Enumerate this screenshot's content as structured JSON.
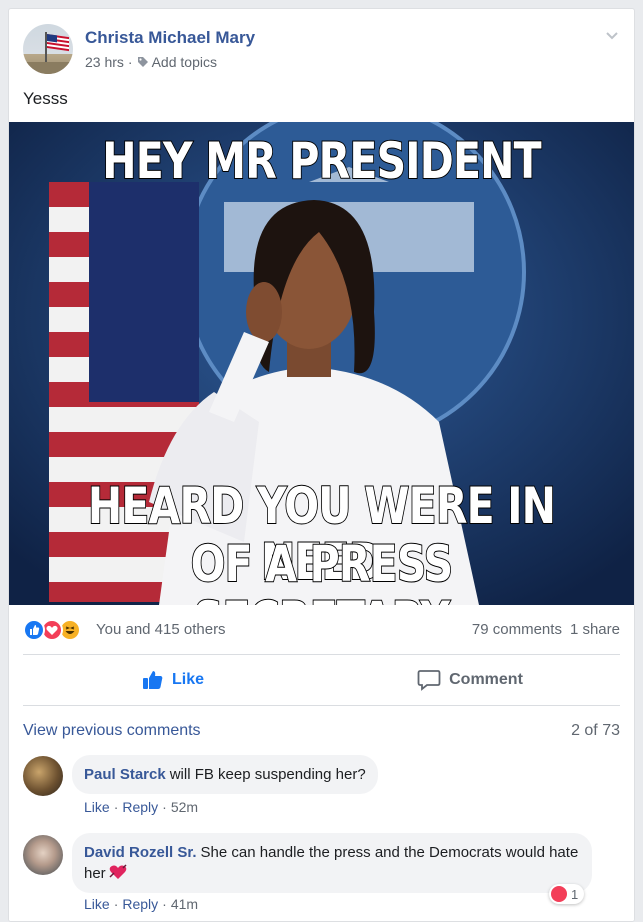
{
  "post": {
    "author": "Christa Michael Mary",
    "time": "23 hrs",
    "add_topics": "Add topics",
    "text": "Yesss",
    "meme_top": "HEY MR PRESIDENT",
    "meme_bottom_1": "HEARD YOU WERE IN NEED",
    "meme_bottom_2": "OF A PRESS SECRETARY",
    "reactors": "You and 415 others",
    "comments_count": "79 comments",
    "shares": "1 share",
    "reaction_icons": [
      "like-icon",
      "love-icon",
      "haha-icon"
    ]
  },
  "actions": {
    "like_label": "Like",
    "comment_label": "Comment"
  },
  "comments": {
    "view_previous": "View previous comments",
    "count": "2 of 73",
    "items": [
      {
        "name": "Paul Starck",
        "text": "will FB keep suspending her?",
        "like": "Like",
        "reply": "Reply",
        "time": "52m"
      },
      {
        "name": "David Rozell Sr.",
        "text": "She can handle the press and the Democrats would hate her",
        "like": "Like",
        "reply": "Reply",
        "time": "41m",
        "reaction_count": "1"
      }
    ]
  },
  "colors": {
    "link": "#385898",
    "like_blue": "#1877f2",
    "love_red": "#f33e58",
    "haha_yellow": "#f7b125",
    "muted": "#606770"
  }
}
